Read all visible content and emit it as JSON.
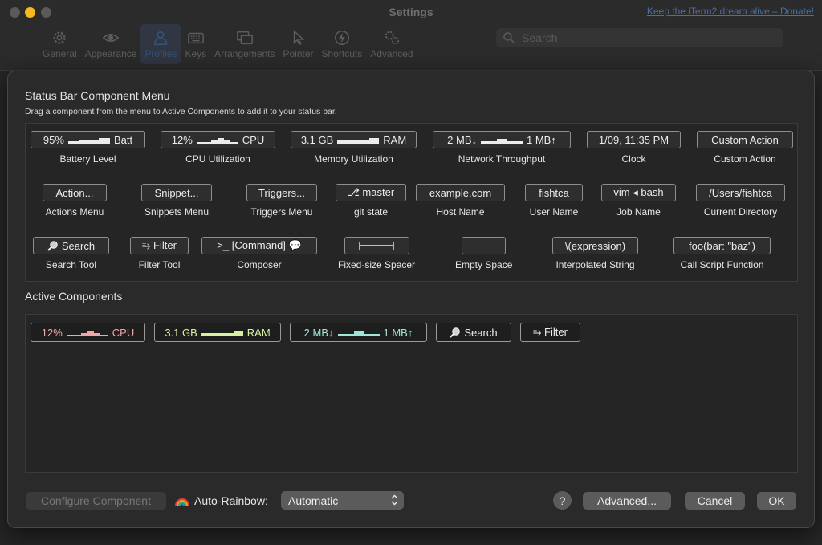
{
  "window": {
    "title": "Settings",
    "donate_link": "Keep the iTerm2 dream alive – Donate!"
  },
  "toolbar": {
    "items": [
      {
        "label": "General",
        "icon": "gear-icon"
      },
      {
        "label": "Appearance",
        "icon": "eye-icon"
      },
      {
        "label": "Profiles",
        "icon": "person-icon",
        "selected": true
      },
      {
        "label": "Keys",
        "icon": "keyboard-icon"
      },
      {
        "label": "Arrangements",
        "icon": "windows-icon"
      },
      {
        "label": "Pointer",
        "icon": "pointer-icon"
      },
      {
        "label": "Shortcuts",
        "icon": "bolt-icon"
      },
      {
        "label": "Advanced",
        "icon": "gears-icon"
      }
    ],
    "search_placeholder": "Search"
  },
  "menu": {
    "title": "Status Bar Component Menu",
    "subtitle": "Drag a component from the menu to Active Components to add it to your status bar.",
    "components": [
      {
        "chip_prefix": "95%",
        "chip_suffix": "Batt",
        "label": "Battery Level"
      },
      {
        "chip_prefix": "12%",
        "chip_suffix": "CPU",
        "label": "CPU Utilization"
      },
      {
        "chip_prefix": "3.1 GB",
        "chip_suffix": "RAM",
        "label": "Memory Utilization"
      },
      {
        "chip_prefix": "2 MB↓",
        "chip_suffix": "1 MB↑",
        "label": "Network Throughput"
      },
      {
        "chip": "1/09, 11:35 PM",
        "label": "Clock"
      },
      {
        "chip": "Custom Action",
        "label": "Custom Action"
      },
      {
        "chip": "Action...",
        "label": "Actions Menu"
      },
      {
        "chip": "Snippet...",
        "label": "Snippets Menu"
      },
      {
        "chip": "Triggers...",
        "label": "Triggers Menu"
      },
      {
        "chip": "⎇ master",
        "label": "git state"
      },
      {
        "chip": "example.com",
        "label": "Host Name"
      },
      {
        "chip": "fishtca",
        "label": "User Name"
      },
      {
        "chip": "vim ◂ bash",
        "label": "Job Name"
      },
      {
        "chip": "/Users/fishtca",
        "label": "Current Directory"
      },
      {
        "chip": "Search",
        "label": "Search Tool"
      },
      {
        "chip": "⥱ Filter",
        "label": "Filter Tool"
      },
      {
        "chip": ">_ [Command] 💬",
        "label": "Composer"
      },
      {
        "chip": "",
        "label": "Fixed-size Spacer"
      },
      {
        "chip": "",
        "label": "Empty Space"
      },
      {
        "chip": "\\(expression)",
        "label": "Interpolated String"
      },
      {
        "chip": "foo(bar: \"baz\")",
        "label": "Call Script Function"
      }
    ]
  },
  "active": {
    "title": "Active Components",
    "components": [
      {
        "prefix": "12%",
        "suffix": "CPU",
        "color": "#f0a6a6"
      },
      {
        "prefix": "3.1 GB",
        "suffix": "RAM",
        "color": "#d9f0a0"
      },
      {
        "prefix": "2 MB↓",
        "suffix": "1 MB↑",
        "color": "#9fe6d9"
      },
      {
        "text": "Search",
        "color": "#ececec"
      },
      {
        "text": "⥱ Filter",
        "color": "#ececec"
      }
    ]
  },
  "footer": {
    "configure_label": "Configure Component",
    "auto_rainbow_label": "Auto-Rainbow:",
    "auto_rainbow_value": "Automatic",
    "help_label": "?",
    "advanced_label": "Advanced...",
    "cancel_label": "Cancel",
    "ok_label": "OK"
  },
  "colors": {
    "accent_selected_tab": "#35507a",
    "cpu": "#f0a6a6",
    "ram": "#d9f0a0",
    "net": "#9fe6d9"
  }
}
